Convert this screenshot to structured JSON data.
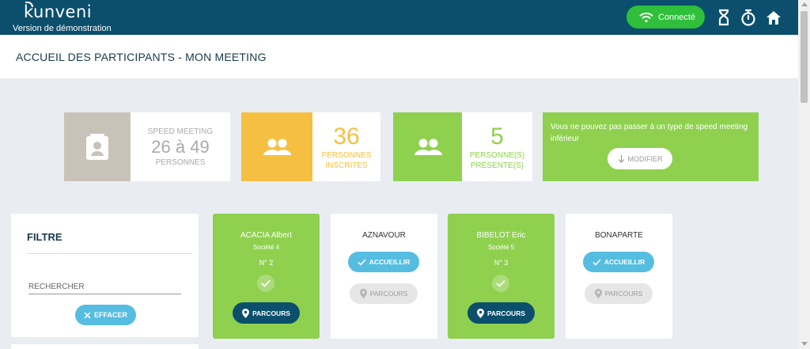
{
  "header": {
    "logo": "kunveni",
    "subtitle": "Version de démonstration",
    "status_label": "Connecté",
    "colors": {
      "bar": "#0b4f6c",
      "connected": "#2fbf3a"
    }
  },
  "page": {
    "title": "ACCUEIL DES PARTICIPANTS - MON MEETING"
  },
  "stats": {
    "speed": {
      "label_top": "SPEED MEETING",
      "value": "26 à 49",
      "label_bottom": "PERSONNES"
    },
    "inscrites": {
      "value": "36",
      "label_1": "PERSONNES",
      "label_2": "INSCRITES"
    },
    "presentes": {
      "value": "5",
      "label_1": "PERSONNE(S)",
      "label_2": "PRÉSENTE(S)"
    },
    "warning": {
      "text": "Vous ne pouvez pas passer à un type de speed meeting inférieur",
      "button_label": "MODIFIER"
    }
  },
  "filter": {
    "title": "FILTRE",
    "search_placeholder": "RECHERCHER",
    "clear_label": "EFFACER"
  },
  "participants": [
    {
      "name": "ACACIA Albert",
      "company": "Société 4",
      "number": "N° 2",
      "present": true,
      "parcours_label": "PARCOURS"
    },
    {
      "name": "AZNAVOUR",
      "present": false,
      "accueillir_label": "ACCUEILLIR",
      "parcours_label": "PARCOURS"
    },
    {
      "name": "BIBELOT Eric",
      "company": "Société 5",
      "number": "N° 3",
      "present": true,
      "parcours_label": "PARCOURS"
    },
    {
      "name": "BONAPARTE",
      "present": false,
      "accueillir_label": "ACCUEILLIR",
      "parcours_label": "PARCOURS"
    }
  ]
}
